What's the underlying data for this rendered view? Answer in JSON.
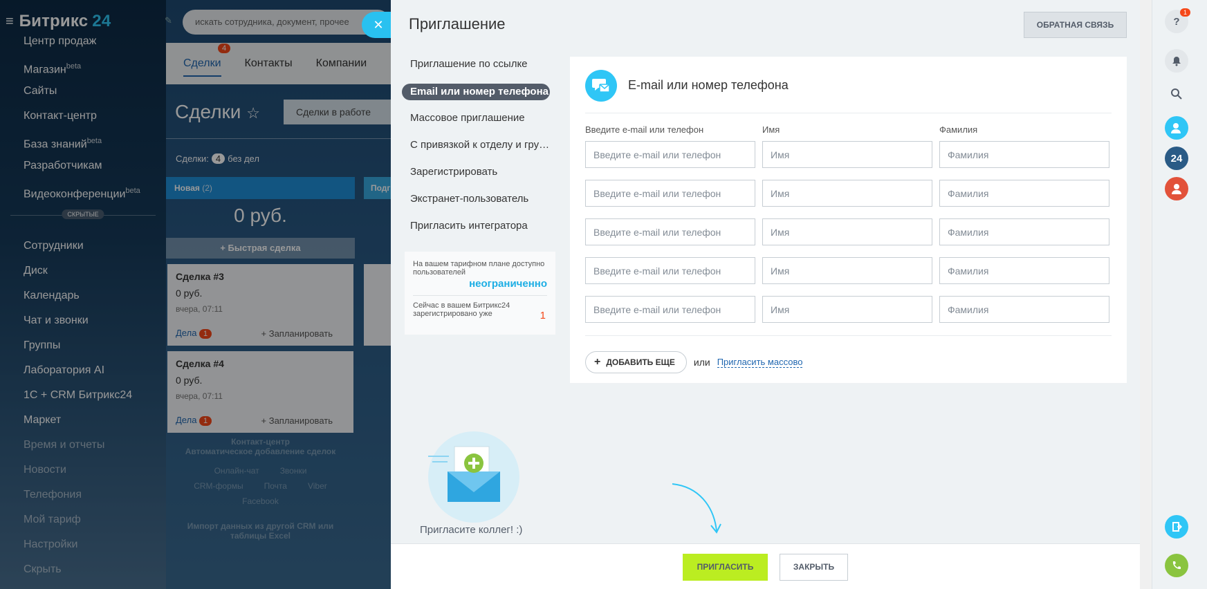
{
  "left_menu": {
    "logo": "Битрикс",
    "logo_num": "24",
    "items": [
      {
        "label": "Центр продаж",
        "sup": ""
      },
      {
        "label": "Магазин",
        "sup": "beta"
      },
      {
        "label": "Сайты",
        "sup": ""
      },
      {
        "label": "Контакт-центр",
        "sup": ""
      },
      {
        "label": "База знаний",
        "sup": "beta"
      },
      {
        "label": "Разработчикам",
        "sup": ""
      },
      {
        "label": "Видеоконференции",
        "sup": "beta"
      }
    ],
    "hidden_label": "СКРЫТЫЕ",
    "hidden_items": [
      "Сотрудники",
      "Диск",
      "Календарь",
      "Чат и звонки",
      "Группы",
      "Лаборатория AI",
      "1С + CRM Битрикс24",
      "Маркет",
      "Время и отчеты",
      "Новости",
      "Телефония",
      "Мой тариф",
      "Настройки",
      "Скрыть"
    ]
  },
  "crm": {
    "search_placeholder": "искать сотрудника, документ, прочее",
    "tabs": [
      {
        "label": "Сделки",
        "badge": "4"
      },
      {
        "label": "Контакты"
      },
      {
        "label": "Компании"
      }
    ],
    "title": "Сделки",
    "filter": "Сделки в работе",
    "deals_label": "Сделки:",
    "deals_count": "4",
    "deals_suffix": "без дел",
    "stage1": "Новая",
    "stage1_count": "(2)",
    "stage2": "Подг",
    "sum": "0 руб.",
    "quick": "Быстрая сделка",
    "cards": [
      {
        "title": "Сделка #3",
        "sum": "0 руб.",
        "date": "вчера, 07:11",
        "tasks": "Дела",
        "tasks_count": "1",
        "plan": "+ Запланировать"
      },
      {
        "title": "Сделка #4",
        "sum": "0 руб.",
        "date": "вчера, 07:11",
        "tasks": "Дела",
        "tasks_count": "1",
        "plan": "+ Запланировать"
      }
    ],
    "cc": {
      "title": "Контакт-центр",
      "subtitle": "Автоматическое добавление сделок",
      "items": [
        "Онлайн-чат",
        "Звонки",
        "CRM-формы",
        "Почта",
        "Viber",
        "Facebook"
      ],
      "import": "Импорт данных из другой CRM или таблицы Excel"
    }
  },
  "panel": {
    "title": "Приглашение",
    "feedback": "ОБРАТНАЯ СВЯЗЬ",
    "tabs": [
      "Приглашение по ссылке",
      "Email или номер телефона",
      "Массовое приглашение",
      "С привязкой к отделу и группам",
      "Зарегистрировать",
      "Экстранет-пользователь",
      "Пригласить интегратора"
    ],
    "limit": {
      "text1": "На вашем тарифном плане доступно пользователей",
      "value1": "неограниченно",
      "text2": "Сейчас в вашем Битрикс24 зарегистрировано уже",
      "value2": "1"
    },
    "form": {
      "title": "E-mail или номер телефона",
      "col_email": "Введите e-mail или телефон",
      "col_name": "Имя",
      "col_last": "Фамилия",
      "ph_email": "Введите e-mail или телефон",
      "ph_name": "Имя",
      "ph_last": "Фамилия",
      "add_more": "ДОБАВИТЬ ЕЩЕ",
      "or": "или",
      "mass_link": "Пригласить массово"
    },
    "illustration_text": "Пригласите коллег! :)",
    "invite_button": "ПРИГЛАСИТЬ",
    "close_button": "ЗАКРЫТЬ"
  },
  "right_bar": {
    "help_badge": "1",
    "bitrix_num": "24"
  }
}
